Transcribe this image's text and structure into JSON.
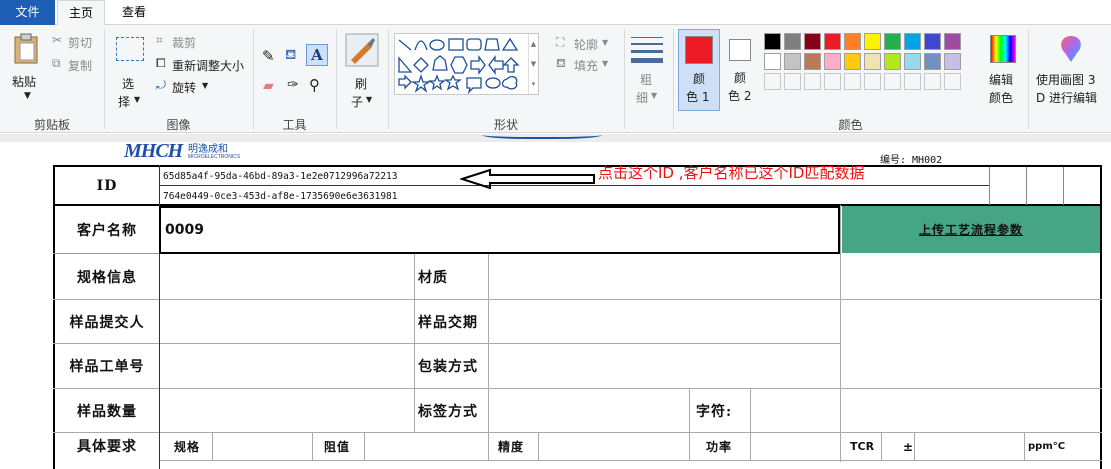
{
  "tabs": {
    "file": "文件",
    "home": "主页",
    "view": "查看"
  },
  "ribbon": {
    "paste": "粘贴",
    "cut": "剪切",
    "copy": "复制",
    "select_top": "选",
    "select_bottom": "择",
    "crop": "裁剪",
    "resize": "重新调整大小",
    "rotate": "旋转",
    "brush_top": "刷",
    "brush_bottom": "子",
    "outline": "轮廓",
    "fill": "填充",
    "size_top": "粗",
    "size_bottom": "细",
    "color1_top": "颜",
    "color1_bottom": "色 1",
    "color2_top": "颜",
    "color2_bottom": "色 2",
    "edit_colors_top": "编辑",
    "edit_colors_bottom": "颜色",
    "paint3d_top": "使用画图 3",
    "paint3d_bottom": "D 进行编辑",
    "groups": {
      "clipboard": "剪贴板",
      "image": "图像",
      "tools": "工具",
      "shapes": "形状",
      "colors": "颜色"
    },
    "color1": "#ed1c24",
    "color2": "#ffffff",
    "palette_row1": [
      "#000000",
      "#7f7f7f",
      "#880015",
      "#ed1c24",
      "#ff7f27",
      "#fff200",
      "#22b14c",
      "#00a2e8",
      "#3f48cc",
      "#a349a4"
    ],
    "palette_row2": [
      "#ffffff",
      "#c3c3c3",
      "#b97a57",
      "#ffaec9",
      "#ffc90e",
      "#efe4b0",
      "#b5e61d",
      "#99d9ea",
      "#7092be",
      "#c8bfe7"
    ]
  },
  "document": {
    "logo_text": "MHCH",
    "logo_cn": "明逸成和",
    "logo_sub": "MICROELECTRONICS",
    "serial": "编号: MH002",
    "id_label": "ID",
    "id_value_1": "65d85a4f-95da-46bd-89a3-1e2e0712996a72213",
    "id_value_2": "764e0449-0ce3-453d-af8e-1735690e6e3631981",
    "annotation": "点击这个ID ,客户名称已这个ID匹配数据",
    "customer_label": "客户名称",
    "customer_value": "0009",
    "upload_button": "上传工艺流程参数",
    "spec_label": "规格信息",
    "material_label": "材质",
    "submitter_label": "样品提交人",
    "delivery_label": "样品交期",
    "order_label": "样品工单号",
    "packing_label": "包装方式",
    "qty_label": "样品数量",
    "tag_label": "标签方式",
    "char_label": "字符:",
    "req_label": "具体要求",
    "req_spec": "规格",
    "req_res": "阻值",
    "req_prec": "精度",
    "req_power": "功率",
    "req_tcr": "TCR",
    "req_pm": "±",
    "req_ppm": "ppm°C",
    "accent": "#45a585"
  }
}
